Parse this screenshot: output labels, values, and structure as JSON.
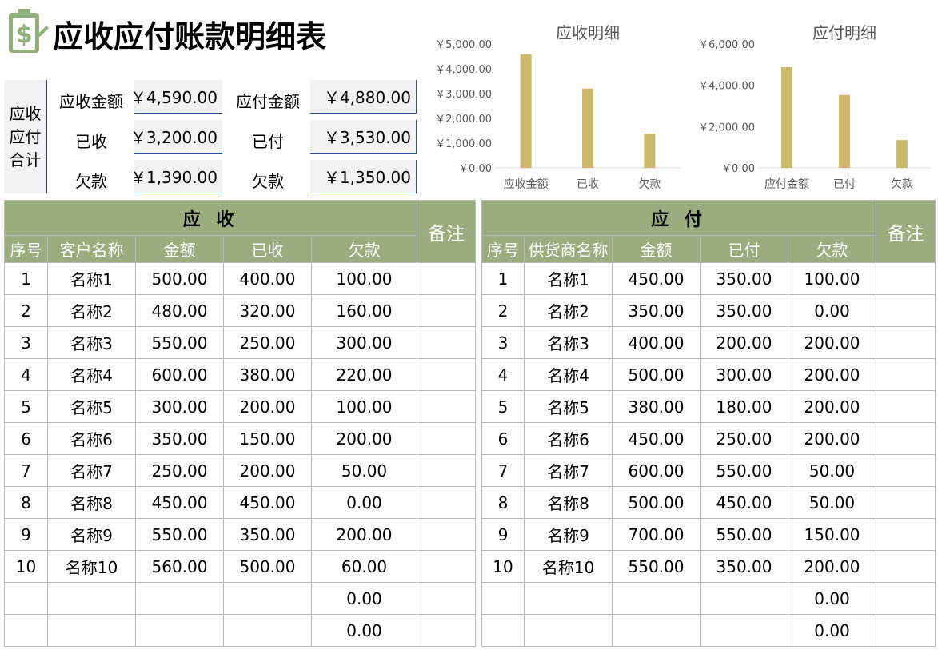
{
  "title": "应收应付账款明细表",
  "summary": {
    "side_label": [
      "应收",
      "应付",
      "合计"
    ],
    "rows": [
      {
        "label_a": "应收金额",
        "value_a": "￥4,590.00",
        "label_b": "应付金额",
        "value_b": "￥4,880.00"
      },
      {
        "label_a": "已收",
        "value_a": "￥3,200.00",
        "label_b": "已付",
        "value_b": "￥3,530.00"
      },
      {
        "label_a": "欠款",
        "value_a": "￥1,390.00",
        "label_b": "欠款",
        "value_b": "￥1,350.00"
      }
    ]
  },
  "colors": {
    "bar": "#cdb76a",
    "header": "#9bad7e",
    "header_text": "#ffffff"
  },
  "chart_data": [
    {
      "type": "bar",
      "title": "应收明细",
      "categories": [
        "应收金额",
        "已收",
        "欠款"
      ],
      "values": [
        4590,
        3200,
        1390
      ],
      "ylim": [
        0,
        5000
      ],
      "yticks": [
        0,
        1000,
        2000,
        3000,
        4000,
        5000
      ],
      "ytick_labels": [
        "￥0.00",
        "￥1,000.00",
        "￥2,000.00",
        "￥3,000.00",
        "￥4,000.00",
        "￥5,000.00"
      ],
      "grid": false
    },
    {
      "type": "bar",
      "title": "应付明细",
      "categories": [
        "应付金额",
        "已付",
        "欠款"
      ],
      "values": [
        4880,
        3530,
        1350
      ],
      "ylim": [
        0,
        6000
      ],
      "yticks": [
        0,
        2000,
        4000,
        6000
      ],
      "ytick_labels": [
        "￥0.00",
        "￥2,000.00",
        "￥4,000.00",
        "￥6,000.00"
      ],
      "grid": false
    }
  ],
  "receivable": {
    "heading": "应 收",
    "remark": "备注",
    "columns": [
      "序号",
      "客户名称",
      "金额",
      "已收",
      "欠款"
    ],
    "rows": [
      [
        "1",
        "名称1",
        "500.00",
        "400.00",
        "100.00"
      ],
      [
        "2",
        "名称2",
        "480.00",
        "320.00",
        "160.00"
      ],
      [
        "3",
        "名称3",
        "550.00",
        "250.00",
        "300.00"
      ],
      [
        "4",
        "名称4",
        "600.00",
        "380.00",
        "220.00"
      ],
      [
        "5",
        "名称5",
        "300.00",
        "200.00",
        "100.00"
      ],
      [
        "6",
        "名称6",
        "350.00",
        "150.00",
        "200.00"
      ],
      [
        "7",
        "名称7",
        "250.00",
        "200.00",
        "50.00"
      ],
      [
        "8",
        "名称8",
        "450.00",
        "450.00",
        "0.00"
      ],
      [
        "9",
        "名称9",
        "550.00",
        "350.00",
        "200.00"
      ],
      [
        "10",
        "名称10",
        "560.00",
        "500.00",
        "60.00"
      ],
      [
        "",
        "",
        "",
        "",
        "0.00"
      ],
      [
        "",
        "",
        "",
        "",
        "0.00"
      ]
    ]
  },
  "payable": {
    "heading": "应 付",
    "remark": "备注",
    "columns": [
      "序号",
      "供货商名称",
      "金额",
      "已付",
      "欠款"
    ],
    "rows": [
      [
        "1",
        "名称1",
        "450.00",
        "350.00",
        "100.00"
      ],
      [
        "2",
        "名称2",
        "350.00",
        "350.00",
        "0.00"
      ],
      [
        "3",
        "名称3",
        "400.00",
        "200.00",
        "200.00"
      ],
      [
        "4",
        "名称4",
        "500.00",
        "300.00",
        "200.00"
      ],
      [
        "5",
        "名称5",
        "380.00",
        "180.00",
        "200.00"
      ],
      [
        "6",
        "名称6",
        "450.00",
        "250.00",
        "200.00"
      ],
      [
        "7",
        "名称7",
        "600.00",
        "550.00",
        "50.00"
      ],
      [
        "8",
        "名称8",
        "500.00",
        "450.00",
        "50.00"
      ],
      [
        "9",
        "名称9",
        "700.00",
        "550.00",
        "150.00"
      ],
      [
        "10",
        "名称10",
        "550.00",
        "350.00",
        "200.00"
      ],
      [
        "",
        "",
        "",
        "",
        "0.00"
      ],
      [
        "",
        "",
        "",
        "",
        "0.00"
      ]
    ]
  }
}
